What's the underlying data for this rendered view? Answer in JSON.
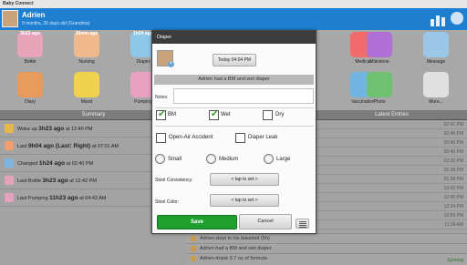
{
  "app": {
    "title": "Baby Connect",
    "child_name": "Adrien",
    "child_sub": "9 months, 26 days old (Grandma)"
  },
  "tiles": [
    {
      "label": "Bottle",
      "ago": "3h23 ago",
      "color": "#e7a3b8"
    },
    {
      "label": "Nursing",
      "ago": "26min ago",
      "color": "#f0b98d"
    },
    {
      "label": "Diaper",
      "ago": "1h24 ago",
      "color": "#8ec7e8"
    },
    {
      "label": "Medical",
      "ago": "",
      "color": "#f26c6c"
    },
    {
      "label": "Milestone",
      "ago": "",
      "color": "#b06fd6"
    },
    {
      "label": "Message",
      "ago": "",
      "color": "#9bc7e9"
    },
    {
      "label": "Diary",
      "ago": "",
      "color": "#e89b5a"
    },
    {
      "label": "Mood",
      "ago": "",
      "color": "#f2d24c"
    },
    {
      "label": "Pumping",
      "ago": "",
      "color": "#e9a1c2"
    },
    {
      "label": "Vaccination",
      "ago": "",
      "color": "#6fb5e0"
    },
    {
      "label": "Photo",
      "ago": "",
      "color": "#6fc06f"
    },
    {
      "label": "More...",
      "ago": "",
      "color": "#e0e0e0"
    }
  ],
  "summary": {
    "header": "Summary",
    "rows": [
      {
        "lead": "Woke up",
        "bold": "3h23 ago",
        "tail": "at 12:40 PM",
        "color": "#e6b84c"
      },
      {
        "lead": "Last",
        "bold": "9h04 ago (Last: Right)",
        "tail": "at 07:01 AM",
        "color": "#f0a070"
      },
      {
        "lead": "Changed",
        "bold": "1h24 ago",
        "tail": "at 02:40 PM",
        "color": "#7fb6e0"
      },
      {
        "lead": "Last Bottle",
        "bold": "3h23 ago",
        "tail": "at 12:42 PM",
        "color": "#e6a3b7"
      },
      {
        "lead": "Last Pumping",
        "bold": "11h23 ago",
        "tail": "at 04:42 AM",
        "color": "#e5a2c0"
      }
    ]
  },
  "entries": {
    "header": "Latest Entries",
    "times": [
      "02:41 PM",
      "02:40 PM",
      "02:40 PM",
      "02:40 PM",
      "02:20 PM",
      "01:38 PM",
      "01:28 PM",
      "12:42 PM",
      "12:40 PM",
      "12:34 PM",
      "12:09 PM",
      "11:09 AM"
    ],
    "bottom": [
      {
        "text": "Adrien slept in his bassinet (5h)"
      },
      {
        "text": "Adrien had a BM and wet diaper"
      },
      {
        "text": "Adrien drank 9.7 oz of formula"
      }
    ],
    "syncing": "Syncing"
  },
  "dialog": {
    "title": "Diaper",
    "time_button": "Today 04:04 PM",
    "summary_text": "Adrien had a BM and wet diaper",
    "notes_label": "Notes:",
    "notes_value": "",
    "checkbox_bm": {
      "label": "BM",
      "checked": true
    },
    "checkbox_wet": {
      "label": "Wet",
      "checked": true
    },
    "checkbox_dry": {
      "label": "Dry",
      "checked": false
    },
    "checkbox_open_air": {
      "label": "Open-Air Accident",
      "checked": false
    },
    "checkbox_diaper_leak": {
      "label": "Diaper Leak",
      "checked": false
    },
    "radio_small": "Small",
    "radio_medium": "Medium",
    "radio_large": "Large",
    "stool_consistency_label": "Stool Consistency:",
    "stool_consistency_button": "< tap to set >",
    "stool_color_label": "Stool Color:",
    "stool_color_button": "< tap to set >",
    "save_label": "Save",
    "cancel_label": "Cancel"
  },
  "colors": {
    "header_blue": "#1e7fd1",
    "save_green": "#1e9f2e",
    "check_green": "#3a9b2c"
  }
}
